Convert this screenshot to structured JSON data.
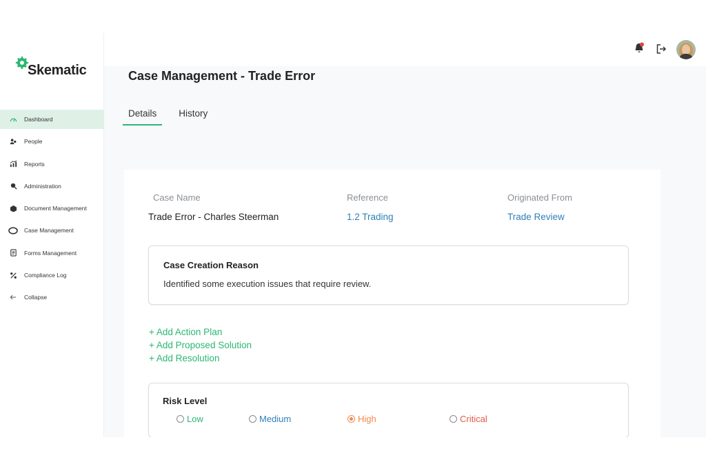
{
  "app": {
    "brand": "Skematic"
  },
  "colors": {
    "accent": "#2bb673",
    "link": "#2e7fb8",
    "active_nav_bg": "#dff1e7"
  },
  "sidebar": {
    "items": [
      {
        "label": "Dashboard",
        "icon": "dashboard-icon",
        "active": true
      },
      {
        "label": "People",
        "icon": "people-icon"
      },
      {
        "label": "Reports",
        "icon": "reports-icon"
      },
      {
        "label": "Administration",
        "icon": "administration-icon"
      },
      {
        "label": "Document Management",
        "icon": "document-icon"
      },
      {
        "label": "Case Management",
        "icon": "case-icon"
      },
      {
        "label": "Forms Management",
        "icon": "forms-icon"
      },
      {
        "label": "Compliance Log",
        "icon": "compliance-icon"
      },
      {
        "label": "Collapse",
        "icon": "arrow-left-icon"
      }
    ]
  },
  "topbar": {
    "icons": [
      "notification-bell-icon",
      "logout-icon",
      "user-avatar"
    ]
  },
  "page": {
    "title": "Case Management - Trade Error",
    "tabs": [
      {
        "label": "Details",
        "active": true
      },
      {
        "label": "History",
        "active": false
      }
    ]
  },
  "details": {
    "case_name": {
      "label": "Case Name",
      "value": "Trade Error - Charles Steerman"
    },
    "reference": {
      "label": "Reference",
      "value": "1.2 Trading"
    },
    "originated_from": {
      "label": "Originated From",
      "value": "Trade Review"
    },
    "reason": {
      "title": "Case Creation Reason",
      "text": "Identified some execution issues that require review."
    },
    "add_links": [
      "+ Add Action Plan",
      "+ Add Proposed Solution",
      "+ Add Resolution"
    ],
    "risk": {
      "title": "Risk Level",
      "selected": "High",
      "options": [
        {
          "label": "Low",
          "color": "#2bb673"
        },
        {
          "label": "Medium",
          "color": "#2e7fb8"
        },
        {
          "label": "High",
          "color": "#f2884b"
        },
        {
          "label": "Critical",
          "color": "#e05a47"
        }
      ]
    }
  }
}
